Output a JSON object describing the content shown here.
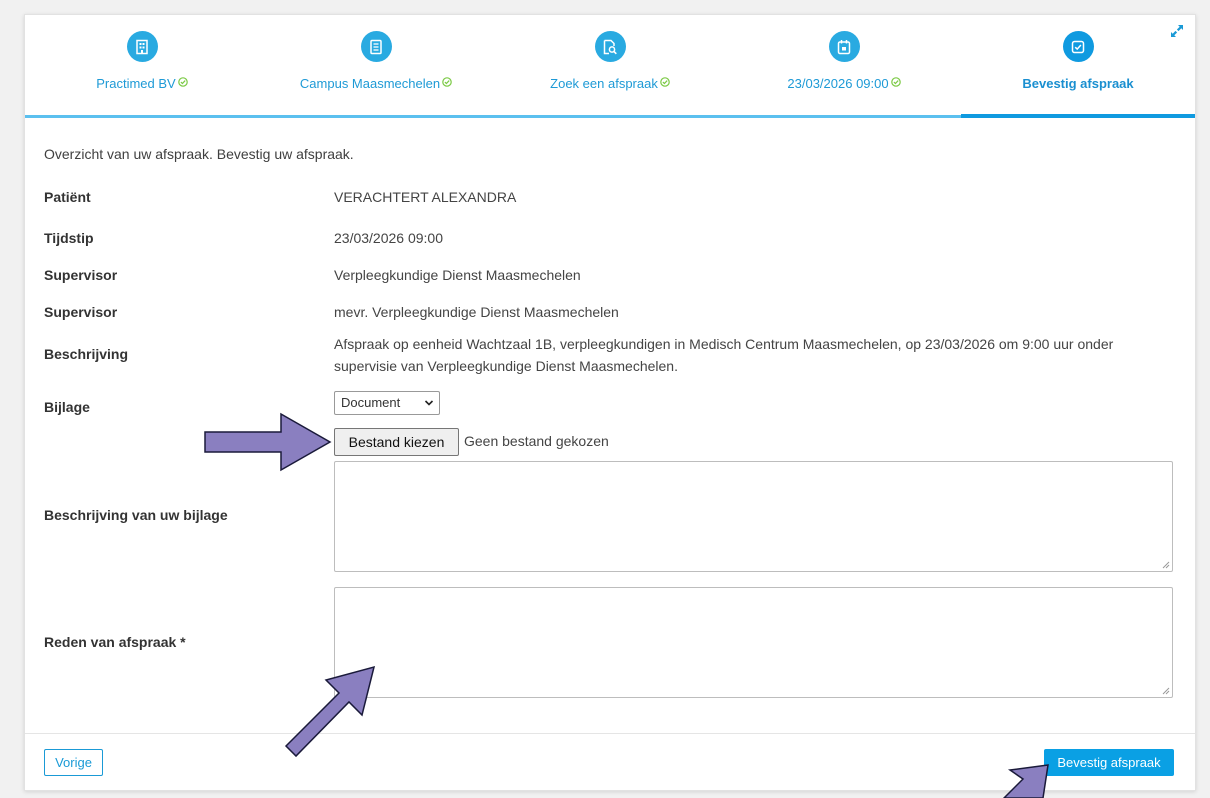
{
  "steps": [
    {
      "label": "Practimed BV",
      "icon": "building-icon",
      "completed": true
    },
    {
      "label": "Campus Maasmechelen",
      "icon": "list-document-icon",
      "completed": true
    },
    {
      "label": "Zoek een afspraak",
      "icon": "search-document-icon",
      "completed": true
    },
    {
      "label": "23/03/2026 09:00",
      "icon": "calendar-icon",
      "completed": true
    },
    {
      "label": "Bevestig afspraak",
      "icon": "checkbox-icon",
      "completed": false
    }
  ],
  "intro": "Overzicht van uw afspraak. Bevestig uw afspraak.",
  "details": {
    "patient": {
      "label": "Patiënt",
      "value": "VERACHTERT ALEXANDRA"
    },
    "time": {
      "label": "Tijdstip",
      "value": "23/03/2026 09:00"
    },
    "supervisor1": {
      "label": "Supervisor",
      "value": "Verpleegkundige Dienst Maasmechelen"
    },
    "supervisor2": {
      "label": "Supervisor",
      "value": "mevr. Verpleegkundige Dienst Maasmechelen"
    },
    "description": {
      "label": "Beschrijving",
      "value": "Afspraak op eenheid Wachtzaal 1B, verpleegkundigen in Medisch Centrum Maasmechelen, op 23/03/2026 om 9:00 uur onder supervisie van Verpleegkundige Dienst Maasmechelen."
    }
  },
  "attachment": {
    "label": "Bijlage",
    "type_selected": "Document",
    "file_button": "Bestand kiezen",
    "file_status": "Geen bestand gekozen"
  },
  "attachment_description": {
    "label": "Beschrijving van uw bijlage",
    "value": ""
  },
  "reason": {
    "label": "Reden van afspraak *",
    "value": ""
  },
  "buttons": {
    "previous": "Vorige",
    "confirm": "Bevestig afspraak"
  },
  "colors": {
    "accent": "#29aae1",
    "check": "#7ac943",
    "arrow": "#8a7fc0"
  }
}
